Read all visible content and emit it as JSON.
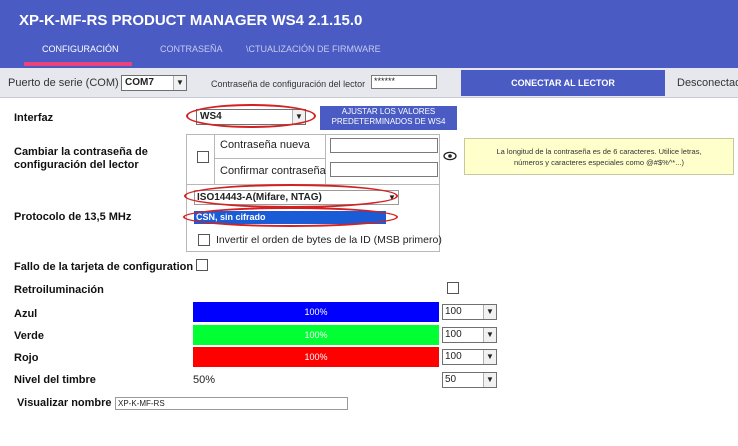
{
  "app": {
    "title": "XP-K-MF-RS   PRODUCT MANAGER WS4 2.1.15.0",
    "tabs": [
      "CONFIGURACIÓN",
      "CONTRASEÑA",
      "\\CTUALIZACIÓN DE FIRMWARE"
    ],
    "active_tab": 0,
    "accent": "#4a5bc4",
    "tab_underline": "#e8437a"
  },
  "connection": {
    "port_label": "Puerto de serie (COM)",
    "port_value": "COM7",
    "password_label": "Contraseña de configuración del lector",
    "password_value": "******",
    "connect_button": "CONECTAR AL LECTOR",
    "status": "Desconectado"
  },
  "interface": {
    "label": "Interfaz",
    "value": "WS4",
    "defaults_button_line1": "AJUSTAR LOS VALORES",
    "defaults_button_line2": "PREDETERMINADOS DE WS4"
  },
  "password_change": {
    "label_line1": "Cambiar la contraseña de",
    "label_line2": "configuración del lector",
    "new_label": "Contraseña nueva",
    "confirm_label": "Confirmar contraseña",
    "new_value": "",
    "confirm_value": "",
    "hint_line1": "La longitud de la contraseña es de 6 caracteres. Utilice letras,",
    "hint_line2": "números y caracteres especiales como @#$%^*...)",
    "checked": false
  },
  "protocol": {
    "label": "Protocolo de 13,5 MHz",
    "selected": "ISO14443-A(Mifare, NTAG)",
    "option_highlighted": "CSN, sin cifrado",
    "invert_label": "Invertir el orden de bytes de la ID (MSB primero)",
    "invert_checked": false
  },
  "config_card": {
    "label": "Fallo de la tarjeta de configuration",
    "checked": false
  },
  "backlight": {
    "label": "Retroiluminación",
    "checked": false,
    "channels": [
      {
        "label": "Azul",
        "text": "100%",
        "level": 100,
        "select": "100",
        "color": "#0000ff"
      },
      {
        "label": "Verde",
        "text": "100%",
        "level": 100,
        "select": "100",
        "color": "#00ff33"
      },
      {
        "label": "Rojo",
        "text": "100%",
        "level": 100,
        "select": "100",
        "color": "#ff0000"
      }
    ]
  },
  "buzzer": {
    "label": "Nivel del timbre",
    "text": "50%",
    "select": "50"
  },
  "display_name": {
    "label": "Visualizar nombre",
    "value": "XP-K-MF-RS"
  },
  "highlight_color": "#d42020"
}
